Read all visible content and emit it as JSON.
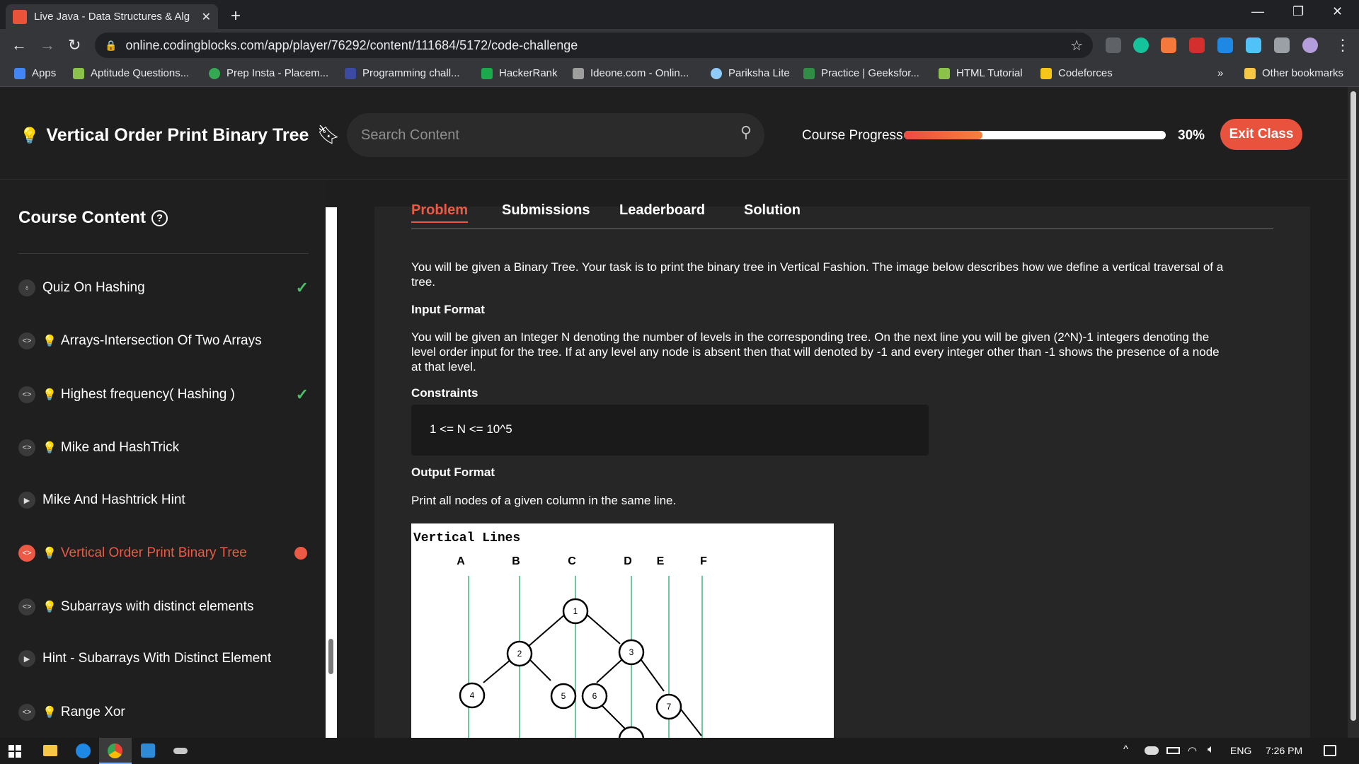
{
  "browser": {
    "tab_title": "Live Java - Data Structures & Alg",
    "url": "online.codingblocks.com/app/player/76292/content/111684/5172/code-challenge",
    "bookmarks": [
      {
        "label": "Apps",
        "color": "#4285f4"
      },
      {
        "label": "Aptitude Questions...",
        "color": "#8bc34a"
      },
      {
        "label": "Prep Insta - Placem...",
        "color": "#34a853"
      },
      {
        "label": "Programming chall...",
        "color": "#3b4aa3"
      },
      {
        "label": "HackerRank",
        "color": "#1ba94c"
      },
      {
        "label": "Ideone.com - Onlin...",
        "color": "#9e9e9e"
      },
      {
        "label": "Pariksha Lite",
        "color": "#90caf9"
      },
      {
        "label": "Practice | Geeksfor...",
        "color": "#2f8d46"
      },
      {
        "label": "HTML Tutorial",
        "color": "#8bc34a"
      },
      {
        "label": "Codeforces",
        "color": "#f5c518"
      }
    ],
    "other_bookmarks": "Other bookmarks",
    "more": "»"
  },
  "header": {
    "title": "Vertical Order Print Binary Tree",
    "search_placeholder": "Search Content",
    "progress_label": "Course Progress",
    "progress_value": 0.3,
    "progress_text": "30%",
    "exit_label": "Exit Class"
  },
  "sidebar": {
    "title": "Course Content",
    "items": [
      {
        "label": "Quiz On Hashing",
        "type": "quiz",
        "status": "done"
      },
      {
        "label": "Arrays-Intersection Of Two Arrays",
        "type": "code",
        "status": ""
      },
      {
        "label": "Highest frequency( Hashing )",
        "type": "code",
        "status": "done"
      },
      {
        "label": "Mike and HashTrick",
        "type": "code",
        "status": ""
      },
      {
        "label": "Mike And Hashtrick Hint",
        "type": "video",
        "status": ""
      },
      {
        "label": "Vertical Order Print Binary Tree",
        "type": "code",
        "status": "active"
      },
      {
        "label": "Subarrays with distinct elements",
        "type": "code",
        "status": ""
      },
      {
        "label": "Hint - Subarrays With Distinct Element",
        "type": "video",
        "status": ""
      },
      {
        "label": "Range Xor",
        "type": "code",
        "status": ""
      }
    ]
  },
  "problem": {
    "tabs": [
      "Problem",
      "Submissions",
      "Leaderboard",
      "Solution"
    ],
    "statement_l1": "You will be given a Binary Tree. Your task is to print the binary tree in Vertical Fashion. The image below describes how we define a vertical traversal of a",
    "statement_l2": "tree.",
    "input_heading": "Input Format",
    "input_l1": "You will be given an Integer N denoting the number of levels in the corresponding tree. On the next line you will be given (2^N)-1 integers denoting the",
    "input_l2": "level order input for the tree. If at any level any node is absent then that will denoted by -1 and every integer other than -1 shows the presence of a node",
    "input_l3": "at that level.",
    "constraints_heading": "Constraints",
    "constraints": "1 <= N <= 10^5",
    "output_heading": "Output Format",
    "output_text": "Print all nodes of a given column in the same line.",
    "diagram": {
      "title": "Vertical Lines",
      "columns": [
        "A",
        "B",
        "C",
        "D",
        "E",
        "F"
      ],
      "nodes": [
        "1",
        "2",
        "3",
        "4",
        "5",
        "6",
        "7"
      ]
    }
  },
  "taskbar": {
    "lang": "ENG",
    "time": "7:26 PM"
  }
}
